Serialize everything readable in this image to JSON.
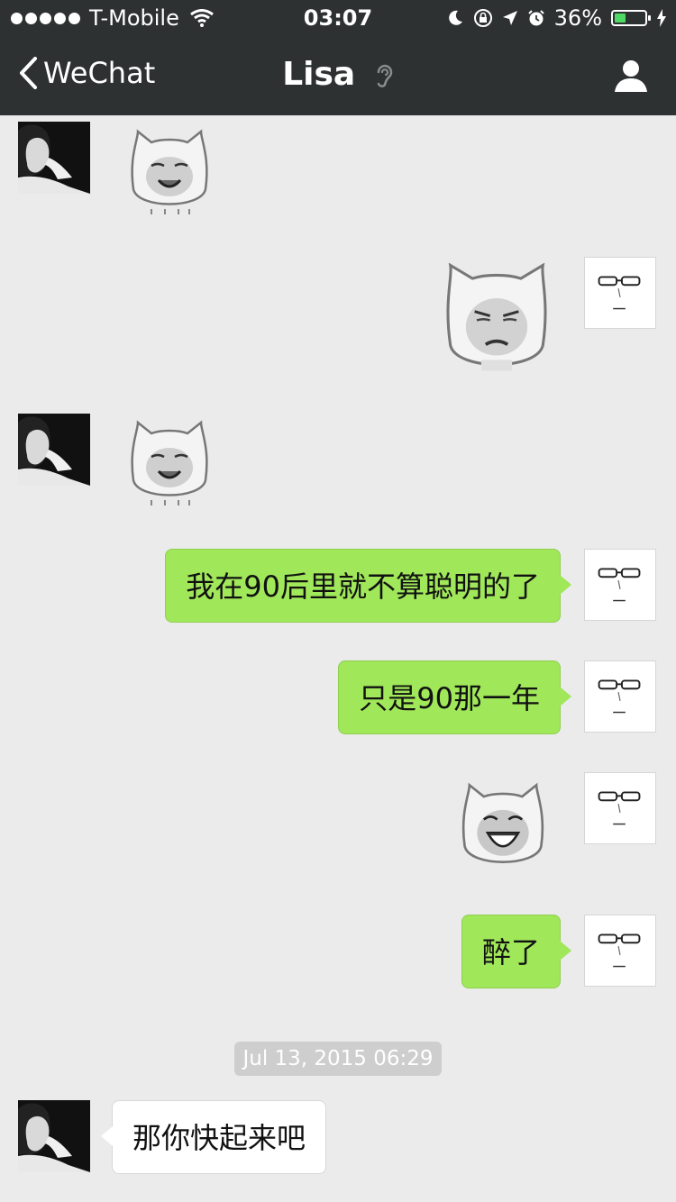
{
  "status_bar": {
    "carrier": "T-Mobile",
    "time": "03:07",
    "battery": "36%",
    "battery_level": 0.36
  },
  "nav": {
    "back_label": "WeChat",
    "title": "Lisa"
  },
  "messages": [
    {
      "side": "in",
      "kind": "sticker",
      "sticker": "laughing-cat-face-sticker"
    },
    {
      "side": "out",
      "kind": "sticker",
      "sticker": "sulking-cat-face-sticker"
    },
    {
      "side": "in",
      "kind": "sticker",
      "sticker": "laughing-cat-face-sticker"
    },
    {
      "side": "out",
      "kind": "text",
      "text": "我在90后里就不算聪明的了"
    },
    {
      "side": "out",
      "kind": "text",
      "text": "只是90那一年"
    },
    {
      "side": "out",
      "kind": "sticker",
      "sticker": "grinning-cat-face-sticker"
    },
    {
      "side": "out",
      "kind": "text",
      "text": "醉了"
    },
    {
      "kind": "timestamp",
      "text": "Jul 13, 2015 06:29"
    },
    {
      "side": "in",
      "kind": "text",
      "text": "那你快起来吧"
    }
  ],
  "colors": {
    "header_bg": "#2e3132",
    "chat_bg": "#ebebeb",
    "outgoing_bubble": "#a0e75a",
    "incoming_bubble": "#ffffff",
    "timestamp_bg": "#cecece"
  }
}
